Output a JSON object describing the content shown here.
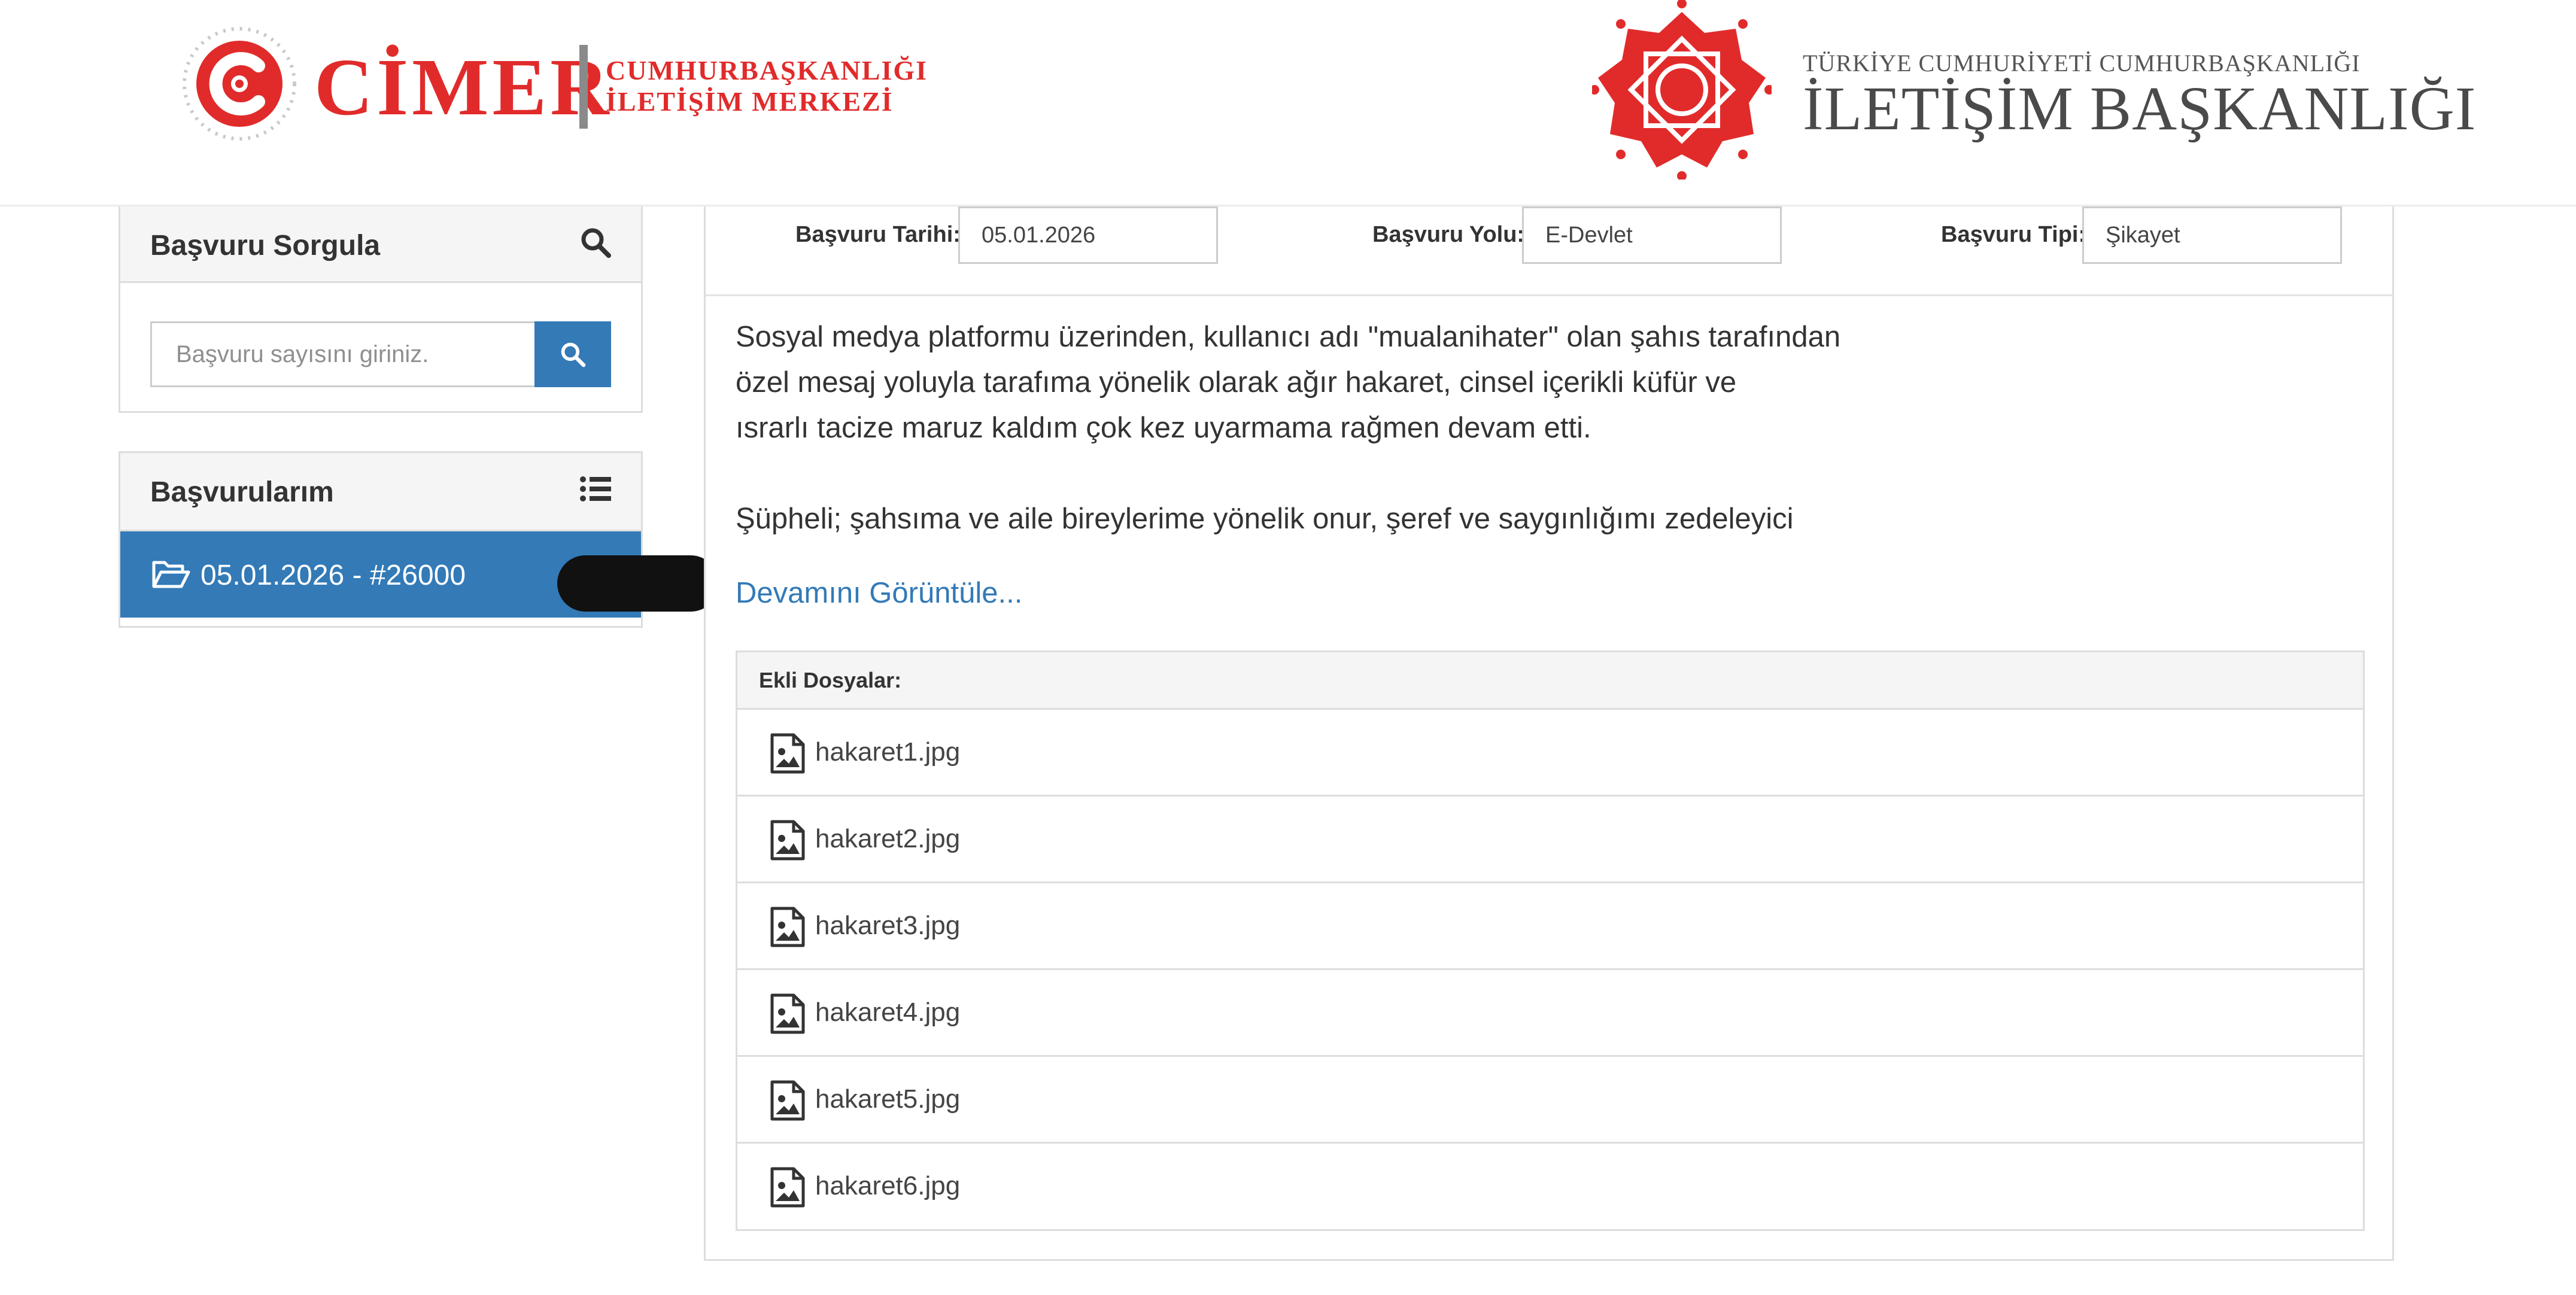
{
  "header": {
    "cimer_logo": {
      "word": "CİMER",
      "sub_line1": "CUMHURBAŞKANLIĞI",
      "sub_line2": "İLETİŞİM MERKEZİ"
    },
    "ib_logo": {
      "small": "TÜRKİYE CUMHURİYETİ CUMHURBAŞKANLIĞI",
      "big": "İLETİŞİM BAŞKANLIĞI"
    }
  },
  "sidebar": {
    "query_panel": {
      "title": "Başvuru Sorgula",
      "search_placeholder": "Başvuru sayısını giriniz.",
      "search_value": ""
    },
    "applications_panel": {
      "title": "Başvurularım",
      "items": [
        {
          "label": "05.01.2026 - #26000"
        }
      ]
    }
  },
  "main": {
    "meta": {
      "date_label": "Başvuru Tarihi:",
      "date_value": "05.01.2026",
      "route_label": "Başvuru Yolu:",
      "route_value": "E-Devlet",
      "type_label": "Başvuru Tipi:",
      "type_value": "Şikayet"
    },
    "description": {
      "lines": [
        "Sosyal medya platformu üzerinden, kullanıcı adı \"mualanihater\" olan şahıs tarafından",
        "özel mesaj yoluyla tarafıma yönelik olarak ağır hakaret, cinsel içerikli küfür ve",
        "ısrarlı tacize maruz kaldım çok kez uyarmama rağmen devam etti.",
        "Şüpheli; şahsıma ve aile bireylerime yönelik onur, şeref ve saygınlığımı zedeleyici"
      ],
      "show_more": "Devamını Görüntüle..."
    },
    "attachments": {
      "header": "Ekli Dosyalar:",
      "files": [
        "hakaret1.jpg",
        "hakaret2.jpg",
        "hakaret3.jpg",
        "hakaret4.jpg",
        "hakaret5.jpg",
        "hakaret6.jpg"
      ]
    }
  },
  "colors": {
    "brand_red": "#e12b2b",
    "primary_blue": "#337ab7",
    "panel_bg": "#f5f5f5",
    "border": "#dddddd"
  }
}
